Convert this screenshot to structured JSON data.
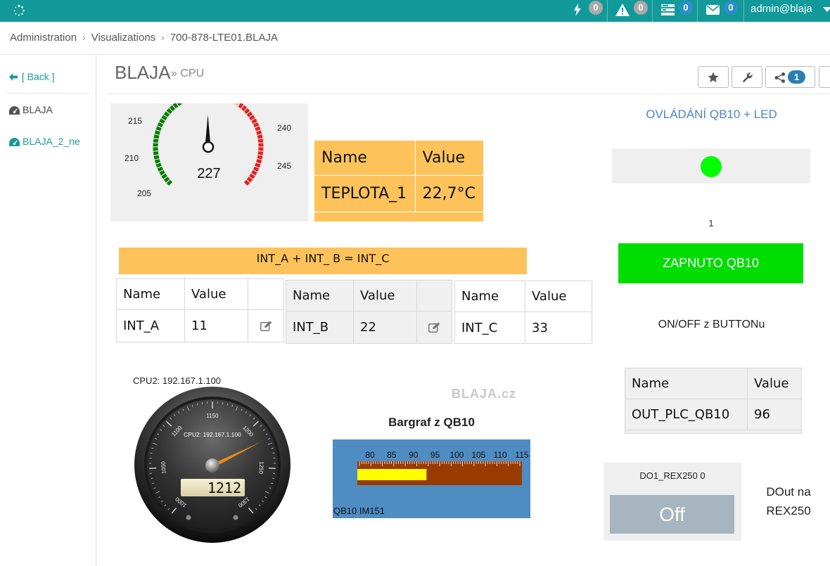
{
  "topbar": {
    "alerts": [
      {
        "icon": "bolt-icon",
        "count": "0"
      },
      {
        "icon": "warning-icon",
        "count": "0"
      },
      {
        "icon": "tasks-icon",
        "count": "0"
      },
      {
        "icon": "envelope-icon",
        "count": "0"
      }
    ],
    "user": "admin@blaja"
  },
  "breadcrumb": [
    "Administration",
    "Visualizations",
    "700-878-LTE01.BLAJA"
  ],
  "sidebar": {
    "back": "[ Back ]",
    "items": [
      {
        "label": "BLAJA",
        "active": false
      },
      {
        "label": "BLAJA_2_ne",
        "active": true
      }
    ]
  },
  "page": {
    "title": "BLAJA",
    "subtitle": "» CPU",
    "share_count": "1"
  },
  "gauge_small": {
    "value": "227",
    "ticks": [
      "205",
      "210",
      "215",
      "240",
      "245"
    ]
  },
  "temp_table": {
    "headers": [
      "Name",
      "Value"
    ],
    "row": [
      "TEPLOTA_1",
      "22,7°C"
    ]
  },
  "int_banner": "INT_A  + INT_ B  = INT_C",
  "int_tables": [
    {
      "headers": [
        "Name",
        "Value"
      ],
      "row": [
        "INT_A",
        "11"
      ],
      "editable": true
    },
    {
      "headers": [
        "Name",
        "Value"
      ],
      "row": [
        "INT_B",
        "22"
      ],
      "editable": true
    },
    {
      "headers": [
        "Name",
        "Value"
      ],
      "row": [
        "INT_C",
        "33"
      ],
      "editable": false
    }
  ],
  "right": {
    "title": "OVLÁDÁNÍ QB10 + LED",
    "led_color": "#00ff00",
    "qb_value": "1",
    "button": "ZAPNUTO QB10",
    "button_color": "#00dd00",
    "onoff_label": "ON/OFF z BUTTONu",
    "out_table": {
      "headers": [
        "Name",
        "Value"
      ],
      "row": [
        "OUT_PLC_QB10",
        "96"
      ]
    },
    "do_label": "DO1_REX250 0",
    "off_button": "Off",
    "dout_label_1": "DOut na",
    "dout_label_2": "REX250"
  },
  "watermark": "BLAJA.cz",
  "cpu_gauge": {
    "label": "CPU2: 192.167.1.100",
    "inner_label": "CPU2: 192.167.1.100",
    "value": "1212",
    "ticks": [
      "1000",
      "1050",
      "1100",
      "1150",
      "1200",
      "1250",
      "1300"
    ]
  },
  "bargraph": {
    "title": "Bargraf z QB10",
    "label": "QB10 IM151",
    "ticks": [
      "80",
      "85",
      "90",
      "95",
      "100",
      "105",
      "110",
      "115"
    ],
    "min": 80,
    "max": 115,
    "value": 96
  }
}
